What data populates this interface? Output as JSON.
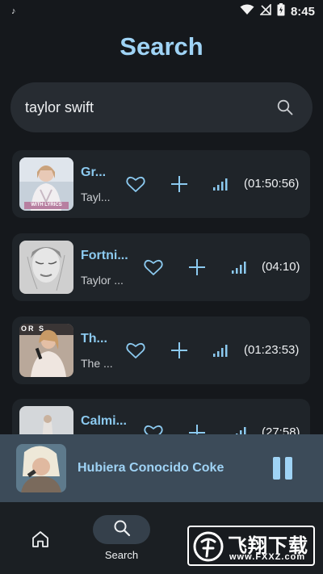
{
  "status_bar": {
    "notification_icon": "music-note-icon",
    "time": "8:45"
  },
  "header": {
    "title": "Search"
  },
  "search": {
    "value": "taylor swift",
    "icon": "search-icon"
  },
  "results": [
    {
      "title": "Gr...",
      "artist": "Tayl...",
      "duration": "(01:50:56)",
      "thumb_caption": "WITH LYRICS",
      "thumb_bg": "#c8d4de"
    },
    {
      "title": "Fortni...",
      "artist": "Taylor ...",
      "duration": "(04:10)",
      "thumb_bg": "#c9c9c9"
    },
    {
      "title": "Th...",
      "artist": "The ...",
      "duration": "(01:23:53)",
      "thumb_caption": "OR S",
      "thumb_bg": "#9e8a7a"
    },
    {
      "title": "Calmi...",
      "artist": "",
      "duration": "(27:58)",
      "thumb_bg": "#cfd3d6"
    }
  ],
  "now_playing": {
    "title": "Hubiera Conocido  Coke",
    "control": "pause-icon"
  },
  "nav": {
    "home_icon": "home-icon",
    "search_icon": "search-icon",
    "search_label": "Search"
  },
  "watermark": {
    "text": "飞翔下载",
    "url": "www.FXXZ.com"
  },
  "colors": {
    "accent": "#9fd3f5",
    "background": "#15181c",
    "card": "#1f2429",
    "player": "#3c4b59"
  }
}
